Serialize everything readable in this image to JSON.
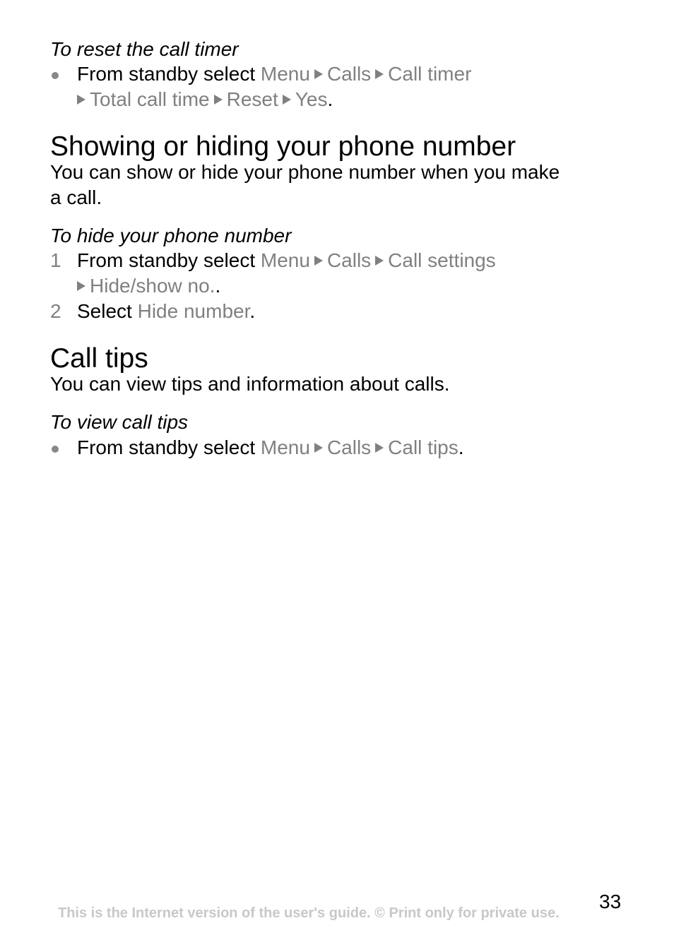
{
  "sections": [
    {
      "subheading": "To reset the call timer",
      "bullet": {
        "prefix": "From standby select",
        "path": [
          "Menu",
          "Calls",
          "Call timer",
          "Total call time",
          "Reset",
          "Yes"
        ],
        "suffix": "."
      }
    },
    {
      "heading": "Showing or hiding your phone number",
      "intro_line1": "You can show or hide your phone number when you make",
      "intro_line2": "a call.",
      "subheading": "To hide your phone number",
      "steps": [
        {
          "number": "1",
          "prefix": "From standby select",
          "path": [
            "Menu",
            "Calls",
            "Call settings",
            "Hide/show no."
          ],
          "suffix": "."
        },
        {
          "number": "2",
          "prefix": "Select",
          "path": [
            "Hide number"
          ],
          "suffix": "."
        }
      ]
    },
    {
      "heading": "Call tips",
      "intro_line1": "You can view tips and information about calls.",
      "subheading": "To view call tips",
      "bullet": {
        "prefix": "From standby select",
        "path": [
          "Menu",
          "Calls",
          "Call tips"
        ],
        "suffix": "."
      }
    }
  ],
  "footer": {
    "notice": "This is the Internet version of the user's guide. © Print only for private use.",
    "page_number": "33"
  },
  "colors": {
    "menu_path": "#808080",
    "footer": "#c8c8c8",
    "text": "#000000"
  }
}
